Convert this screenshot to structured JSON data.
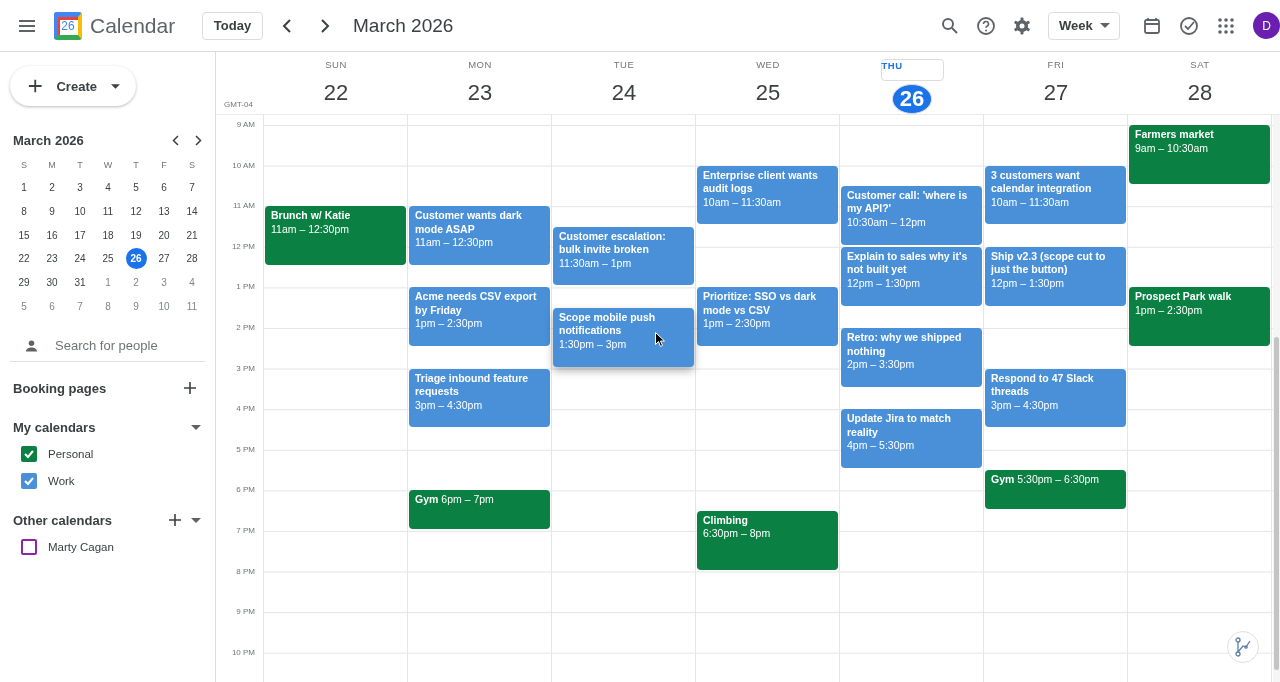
{
  "header": {
    "app_name": "Calendar",
    "logo_text": "26",
    "today_button": "Today",
    "title": "March 2026",
    "view_selector": "Week",
    "avatar_initial": "D"
  },
  "sidebar": {
    "create_button": "Create",
    "mini_calendar": {
      "title": "March 2026",
      "weekdays": [
        "S",
        "M",
        "T",
        "W",
        "T",
        "F",
        "S"
      ],
      "weeks": [
        [
          {
            "day": "1",
            "in_month": true,
            "selected": false
          },
          {
            "day": "2",
            "in_month": true,
            "selected": false
          },
          {
            "day": "3",
            "in_month": true,
            "selected": false
          },
          {
            "day": "4",
            "in_month": true,
            "selected": false
          },
          {
            "day": "5",
            "in_month": true,
            "selected": false
          },
          {
            "day": "6",
            "in_month": true,
            "selected": false
          },
          {
            "day": "7",
            "in_month": true,
            "selected": false
          }
        ],
        [
          {
            "day": "8",
            "in_month": true,
            "selected": false
          },
          {
            "day": "9",
            "in_month": true,
            "selected": false
          },
          {
            "day": "10",
            "in_month": true,
            "selected": false
          },
          {
            "day": "11",
            "in_month": true,
            "selected": false
          },
          {
            "day": "12",
            "in_month": true,
            "selected": false
          },
          {
            "day": "13",
            "in_month": true,
            "selected": false
          },
          {
            "day": "14",
            "in_month": true,
            "selected": false
          }
        ],
        [
          {
            "day": "15",
            "in_month": true,
            "selected": false
          },
          {
            "day": "16",
            "in_month": true,
            "selected": false
          },
          {
            "day": "17",
            "in_month": true,
            "selected": false
          },
          {
            "day": "18",
            "in_month": true,
            "selected": false
          },
          {
            "day": "19",
            "in_month": true,
            "selected": false
          },
          {
            "day": "20",
            "in_month": true,
            "selected": false
          },
          {
            "day": "21",
            "in_month": true,
            "selected": false
          }
        ],
        [
          {
            "day": "22",
            "in_month": true,
            "selected": false
          },
          {
            "day": "23",
            "in_month": true,
            "selected": false
          },
          {
            "day": "24",
            "in_month": true,
            "selected": false
          },
          {
            "day": "25",
            "in_month": true,
            "selected": false
          },
          {
            "day": "26",
            "in_month": true,
            "selected": true
          },
          {
            "day": "27",
            "in_month": true,
            "selected": false
          },
          {
            "day": "28",
            "in_month": true,
            "selected": false
          }
        ],
        [
          {
            "day": "29",
            "in_month": true,
            "selected": false
          },
          {
            "day": "30",
            "in_month": true,
            "selected": false
          },
          {
            "day": "31",
            "in_month": true,
            "selected": false
          },
          {
            "day": "1",
            "in_month": false,
            "selected": false
          },
          {
            "day": "2",
            "in_month": false,
            "selected": false
          },
          {
            "day": "3",
            "in_month": false,
            "selected": false
          },
          {
            "day": "4",
            "in_month": false,
            "selected": false
          }
        ],
        [
          {
            "day": "5",
            "in_month": false,
            "selected": false
          },
          {
            "day": "6",
            "in_month": false,
            "selected": false
          },
          {
            "day": "7",
            "in_month": false,
            "selected": false
          },
          {
            "day": "8",
            "in_month": false,
            "selected": false
          },
          {
            "day": "9",
            "in_month": false,
            "selected": false
          },
          {
            "day": "10",
            "in_month": false,
            "selected": false
          },
          {
            "day": "11",
            "in_month": false,
            "selected": false
          }
        ]
      ]
    },
    "people_search": {
      "placeholder": "Search for people"
    },
    "booking_pages": {
      "title": "Booking pages"
    },
    "my_calendars": {
      "title": "My calendars",
      "expanded": true,
      "items": [
        {
          "name": "Personal",
          "checked": true,
          "color": "#0b8043"
        },
        {
          "name": "Work",
          "checked": true,
          "color": "#4a90d9"
        }
      ]
    },
    "other_calendars": {
      "title": "Other calendars",
      "expanded": true,
      "items": [
        {
          "name": "Marty Cagan",
          "checked": false,
          "color": "#8e24aa"
        }
      ]
    }
  },
  "week": {
    "timezone": "GMT-04",
    "hours": [
      "9 AM",
      "10 AM",
      "11 AM",
      "12 PM",
      "1 PM",
      "2 PM",
      "3 PM",
      "4 PM",
      "5 PM",
      "6 PM",
      "7 PM",
      "8 PM",
      "9 PM",
      "10 PM"
    ],
    "days": [
      {
        "name": "SUN",
        "date": "22",
        "selected": false,
        "events": [
          {
            "title": "Brunch w/ Katie",
            "time": "11am – 12:30pm",
            "color": "#0b8043",
            "kind": "stacked",
            "hovered": false
          }
        ]
      },
      {
        "name": "MON",
        "date": "23",
        "selected": false,
        "events": [
          {
            "title": "Customer wants dark mode ASAP",
            "time": "11am – 12:30pm",
            "color": "#4a90d9",
            "kind": "stacked",
            "hovered": false
          },
          {
            "title": "Acme needs CSV export by Friday",
            "time": "1pm – 2:30pm",
            "color": "#4a90d9",
            "kind": "stacked",
            "hovered": false
          },
          {
            "title": "Triage inbound feature requests",
            "time": "3pm – 4:30pm",
            "color": "#4a90d9",
            "kind": "stacked",
            "hovered": false
          },
          {
            "title": "Gym",
            "time": "6pm – 7pm",
            "color": "#0b8043",
            "kind": "inline",
            "hovered": false
          }
        ]
      },
      {
        "name": "TUE",
        "date": "24",
        "selected": false,
        "events": [
          {
            "title": "Customer escalation: bulk invite broken",
            "time": "11:30am – 1pm",
            "color": "#4a90d9",
            "kind": "stacked",
            "hovered": false
          },
          {
            "title": "Scope mobile push notifications",
            "time": "1:30pm – 3pm",
            "color": "#4a90d9",
            "kind": "stacked",
            "hovered": true
          }
        ]
      },
      {
        "name": "WED",
        "date": "25",
        "selected": false,
        "events": [
          {
            "title": "Enterprise client wants audit logs",
            "time": "10am – 11:30am",
            "color": "#4a90d9",
            "kind": "stacked",
            "hovered": false
          },
          {
            "title": "Prioritize: SSO vs dark mode vs CSV",
            "time": "1pm – 2:30pm",
            "color": "#4a90d9",
            "kind": "stacked",
            "hovered": false
          },
          {
            "title": "Climbing",
            "time": "6:30pm – 8pm",
            "color": "#0b8043",
            "kind": "stacked",
            "hovered": false
          }
        ]
      },
      {
        "name": "THU",
        "date": "26",
        "selected": true,
        "events": [
          {
            "title": "Customer call: 'where is my API?'",
            "time": "10:30am – 12pm",
            "color": "#4a90d9",
            "kind": "stacked",
            "hovered": false
          },
          {
            "title": "Explain to sales why it's not built yet",
            "time": "12pm – 1:30pm",
            "color": "#4a90d9",
            "kind": "stacked",
            "hovered": false
          },
          {
            "title": "Retro: why we shipped nothing",
            "time": "2pm – 3:30pm",
            "color": "#4a90d9",
            "kind": "stacked",
            "hovered": false
          },
          {
            "title": "Update Jira to match reality",
            "time": "4pm – 5:30pm",
            "color": "#4a90d9",
            "kind": "stacked",
            "hovered": false
          }
        ]
      },
      {
        "name": "FRI",
        "date": "27",
        "selected": false,
        "events": [
          {
            "title": "3 customers want calendar integration",
            "time": "10am – 11:30am",
            "color": "#4a90d9",
            "kind": "stacked",
            "hovered": false
          },
          {
            "title": "Ship v2.3 (scope cut to just the button)",
            "time": "12pm – 1:30pm",
            "color": "#4a90d9",
            "kind": "stacked",
            "hovered": false
          },
          {
            "title": "Respond to 47 Slack threads",
            "time": "3pm – 4:30pm",
            "color": "#4a90d9",
            "kind": "stacked",
            "hovered": false
          },
          {
            "title": "Gym",
            "time": "5:30pm – 6:30pm",
            "color": "#0b8043",
            "kind": "inline",
            "hovered": false
          }
        ]
      },
      {
        "name": "SAT",
        "date": "28",
        "selected": false,
        "events": [
          {
            "title": "Farmers market",
            "time": "9am – 10:30am",
            "color": "#0b8043",
            "kind": "stacked",
            "hovered": false
          },
          {
            "title": "Prospect Park walk",
            "time": "1pm – 2:30pm",
            "color": "#0b8043",
            "kind": "stacked",
            "hovered": false
          }
        ]
      }
    ]
  }
}
